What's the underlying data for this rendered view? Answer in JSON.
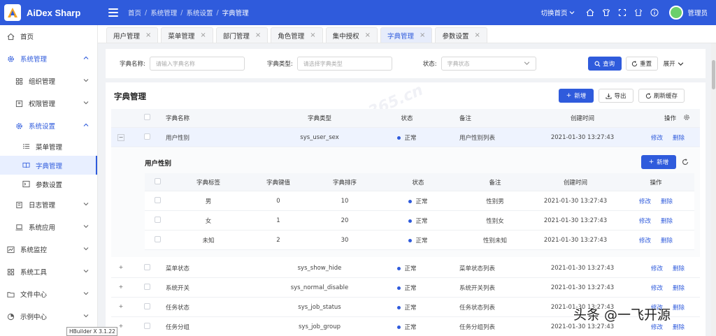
{
  "app": {
    "title": "AiDex Sharp",
    "brand_color": "#2f5bdc"
  },
  "header": {
    "breadcrumb": [
      "首页",
      "系统管理",
      "系统设置",
      "字典管理"
    ],
    "home_switch": "切换首页",
    "user": "管理员",
    "icons": [
      "home-icon",
      "clothes-icon",
      "fullscreen-icon",
      "tshirt-icon",
      "info-icon"
    ]
  },
  "sidebar": {
    "items": [
      {
        "label": "首页",
        "icon": "home-icon"
      },
      {
        "label": "系统管理",
        "icon": "gear-icon"
      },
      {
        "label": "组织管理",
        "icon": "grid-icon"
      },
      {
        "label": "权限管理",
        "icon": "permission-icon"
      },
      {
        "label": "系统设置",
        "icon": "gear-icon"
      },
      {
        "label": "菜单管理",
        "icon": "list-icon"
      },
      {
        "label": "字典管理",
        "icon": "book-icon"
      },
      {
        "label": "参数设置",
        "icon": "terminal-icon"
      },
      {
        "label": "日志管理",
        "icon": "log-icon"
      },
      {
        "label": "系统应用",
        "icon": "laptop-icon"
      },
      {
        "label": "系统监控",
        "icon": "chart-icon"
      },
      {
        "label": "系统工具",
        "icon": "grid-icon"
      },
      {
        "label": "文件中心",
        "icon": "folder-icon"
      },
      {
        "label": "示例中心",
        "icon": "pie-icon"
      }
    ]
  },
  "tabs": [
    {
      "label": "用户管理"
    },
    {
      "label": "菜单管理"
    },
    {
      "label": "部门管理"
    },
    {
      "label": "角色管理"
    },
    {
      "label": "集中授权"
    },
    {
      "label": "字典管理"
    },
    {
      "label": "参数设置"
    }
  ],
  "search": {
    "name_label": "字典名称:",
    "name_placeholder": "请输入字典名称",
    "type_label": "字典类型:",
    "type_placeholder": "请选择字典类型",
    "status_label": "状态:",
    "status_placeholder": "字典状态",
    "query_button": "查询",
    "reset_button": "重置",
    "expand_button": "展开"
  },
  "main": {
    "title": "字典管理",
    "add_button": "新增",
    "export_button": "导出",
    "refresh_cache_button": "刷新缓存",
    "columns": [
      "字典名称",
      "字典类型",
      "状态",
      "备注",
      "创建时间",
      "操作"
    ],
    "edit_label": "修改",
    "delete_label": "删除",
    "rows": [
      {
        "name": "用户性别",
        "type": "sys_user_sex",
        "status": "正常",
        "remark": "用户性别列表",
        "created": "2021-01-30 13:27:43"
      },
      {
        "name": "菜单状态",
        "type": "sys_show_hide",
        "status": "正常",
        "remark": "菜单状态列表",
        "created": "2021-01-30 13:27:43"
      },
      {
        "name": "系统开关",
        "type": "sys_normal_disable",
        "status": "正常",
        "remark": "系统开关列表",
        "created": "2021-01-30 13:27:43"
      },
      {
        "name": "任务状态",
        "type": "sys_job_status",
        "status": "正常",
        "remark": "任务状态列表",
        "created": "2021-01-30 13:27:43"
      },
      {
        "name": "任务分组",
        "type": "sys_job_group",
        "status": "正常",
        "remark": "任务分组列表",
        "created": "2021-01-30 13:27:43"
      }
    ]
  },
  "sub": {
    "title": "用户性别",
    "add_button": "新增",
    "columns": [
      "字典标签",
      "字典键值",
      "字典排序",
      "状态",
      "备注",
      "创建时间",
      "操作"
    ],
    "rows": [
      {
        "label": "男",
        "value": "0",
        "sort": "10",
        "status": "正常",
        "remark": "性别男",
        "created": "2021-01-30 13:27:43"
      },
      {
        "label": "女",
        "value": "1",
        "sort": "20",
        "status": "正常",
        "remark": "性别女",
        "created": "2021-01-30 13:27:43"
      },
      {
        "label": "未知",
        "value": "2",
        "sort": "30",
        "status": "正常",
        "remark": "性别未知",
        "created": "2021-01-30 13:27:43"
      }
    ]
  },
  "overlay": {
    "hbuilder": "HBuilder X 3.1.22",
    "credit": "头条 @一飞开源",
    "watermark": "admin365.cn"
  }
}
